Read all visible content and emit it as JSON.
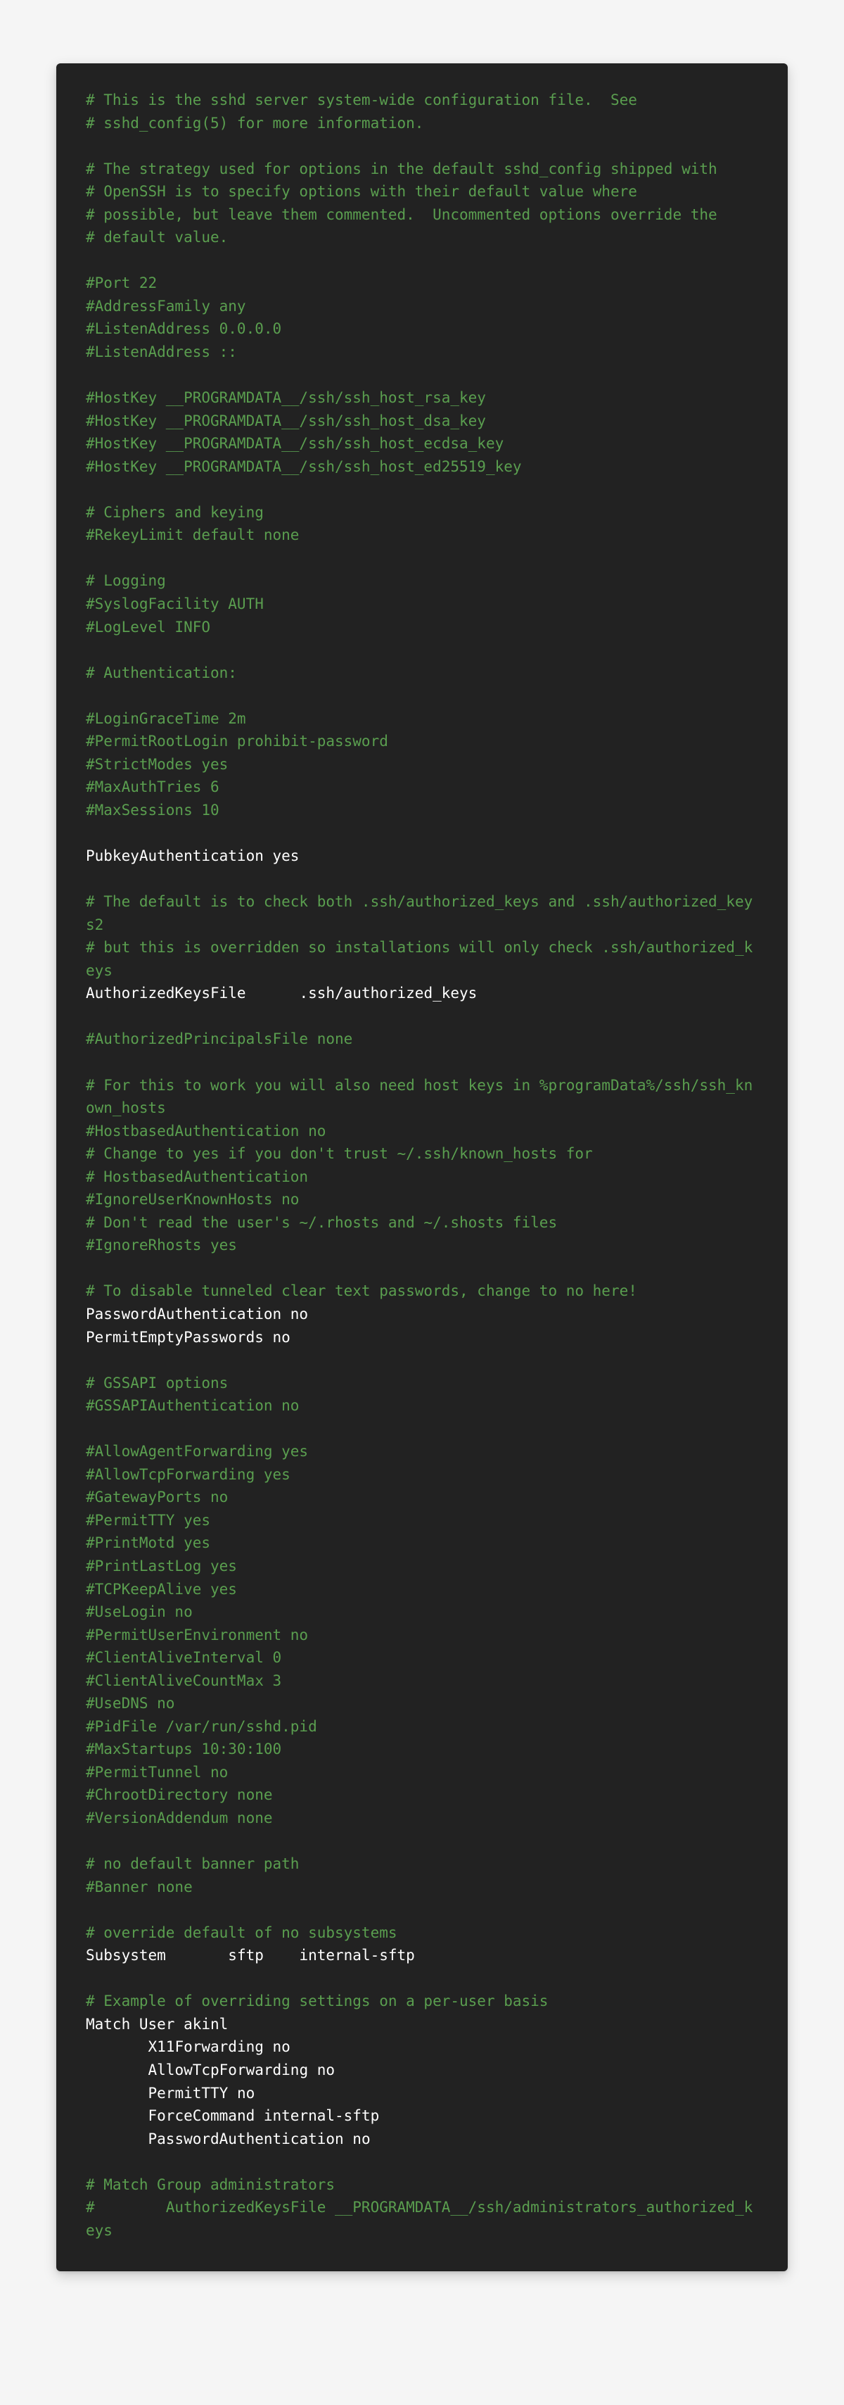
{
  "config": {
    "lines": [
      {
        "text": "# This is the sshd server system-wide configuration file.  See",
        "kind": "comment"
      },
      {
        "text": "# sshd_config(5) for more information.",
        "kind": "comment"
      },
      {
        "text": "",
        "kind": "blank"
      },
      {
        "text": "# The strategy used for options in the default sshd_config shipped with",
        "kind": "comment"
      },
      {
        "text": "# OpenSSH is to specify options with their default value where",
        "kind": "comment"
      },
      {
        "text": "# possible, but leave them commented.  Uncommented options override the",
        "kind": "comment"
      },
      {
        "text": "# default value.",
        "kind": "comment"
      },
      {
        "text": "",
        "kind": "blank"
      },
      {
        "text": "#Port 22",
        "kind": "comment"
      },
      {
        "text": "#AddressFamily any",
        "kind": "comment"
      },
      {
        "text": "#ListenAddress 0.0.0.0",
        "kind": "comment"
      },
      {
        "text": "#ListenAddress ::",
        "kind": "comment"
      },
      {
        "text": "",
        "kind": "blank"
      },
      {
        "text": "#HostKey __PROGRAMDATA__/ssh/ssh_host_rsa_key",
        "kind": "comment"
      },
      {
        "text": "#HostKey __PROGRAMDATA__/ssh/ssh_host_dsa_key",
        "kind": "comment"
      },
      {
        "text": "#HostKey __PROGRAMDATA__/ssh/ssh_host_ecdsa_key",
        "kind": "comment"
      },
      {
        "text": "#HostKey __PROGRAMDATA__/ssh/ssh_host_ed25519_key",
        "kind": "comment"
      },
      {
        "text": "",
        "kind": "blank"
      },
      {
        "text": "# Ciphers and keying",
        "kind": "comment"
      },
      {
        "text": "#RekeyLimit default none",
        "kind": "comment"
      },
      {
        "text": "",
        "kind": "blank"
      },
      {
        "text": "# Logging",
        "kind": "comment"
      },
      {
        "text": "#SyslogFacility AUTH",
        "kind": "comment"
      },
      {
        "text": "#LogLevel INFO",
        "kind": "comment"
      },
      {
        "text": "",
        "kind": "blank"
      },
      {
        "text": "# Authentication:",
        "kind": "comment"
      },
      {
        "text": "",
        "kind": "blank"
      },
      {
        "text": "#LoginGraceTime 2m",
        "kind": "comment"
      },
      {
        "text": "#PermitRootLogin prohibit-password",
        "kind": "comment"
      },
      {
        "text": "#StrictModes yes",
        "kind": "comment"
      },
      {
        "text": "#MaxAuthTries 6",
        "kind": "comment"
      },
      {
        "text": "#MaxSessions 10",
        "kind": "comment"
      },
      {
        "text": "",
        "kind": "blank"
      },
      {
        "text": "PubkeyAuthentication yes",
        "kind": "active"
      },
      {
        "text": "",
        "kind": "blank"
      },
      {
        "text": "# The default is to check both .ssh/authorized_keys and .ssh/authorized_keys2",
        "kind": "comment"
      },
      {
        "text": "# but this is overridden so installations will only check .ssh/authorized_keys",
        "kind": "comment"
      },
      {
        "text": "AuthorizedKeysFile\t.ssh/authorized_keys",
        "kind": "active"
      },
      {
        "text": "",
        "kind": "blank"
      },
      {
        "text": "#AuthorizedPrincipalsFile none",
        "kind": "comment"
      },
      {
        "text": "",
        "kind": "blank"
      },
      {
        "text": "# For this to work you will also need host keys in %programData%/ssh/ssh_known_hosts",
        "kind": "comment"
      },
      {
        "text": "#HostbasedAuthentication no",
        "kind": "comment"
      },
      {
        "text": "# Change to yes if you don't trust ~/.ssh/known_hosts for",
        "kind": "comment"
      },
      {
        "text": "# HostbasedAuthentication",
        "kind": "comment"
      },
      {
        "text": "#IgnoreUserKnownHosts no",
        "kind": "comment"
      },
      {
        "text": "# Don't read the user's ~/.rhosts and ~/.shosts files",
        "kind": "comment"
      },
      {
        "text": "#IgnoreRhosts yes",
        "kind": "comment"
      },
      {
        "text": "",
        "kind": "blank"
      },
      {
        "text": "# To disable tunneled clear text passwords, change to no here!",
        "kind": "comment"
      },
      {
        "text": "PasswordAuthentication no",
        "kind": "active"
      },
      {
        "text": "PermitEmptyPasswords no",
        "kind": "active"
      },
      {
        "text": "",
        "kind": "blank"
      },
      {
        "text": "# GSSAPI options",
        "kind": "comment"
      },
      {
        "text": "#GSSAPIAuthentication no",
        "kind": "comment"
      },
      {
        "text": "",
        "kind": "blank"
      },
      {
        "text": "#AllowAgentForwarding yes",
        "kind": "comment"
      },
      {
        "text": "#AllowTcpForwarding yes",
        "kind": "comment"
      },
      {
        "text": "#GatewayPorts no",
        "kind": "comment"
      },
      {
        "text": "#PermitTTY yes",
        "kind": "comment"
      },
      {
        "text": "#PrintMotd yes",
        "kind": "comment"
      },
      {
        "text": "#PrintLastLog yes",
        "kind": "comment"
      },
      {
        "text": "#TCPKeepAlive yes",
        "kind": "comment"
      },
      {
        "text": "#UseLogin no",
        "kind": "comment"
      },
      {
        "text": "#PermitUserEnvironment no",
        "kind": "comment"
      },
      {
        "text": "#ClientAliveInterval 0",
        "kind": "comment"
      },
      {
        "text": "#ClientAliveCountMax 3",
        "kind": "comment"
      },
      {
        "text": "#UseDNS no",
        "kind": "comment"
      },
      {
        "text": "#PidFile /var/run/sshd.pid",
        "kind": "comment"
      },
      {
        "text": "#MaxStartups 10:30:100",
        "kind": "comment"
      },
      {
        "text": "#PermitTunnel no",
        "kind": "comment"
      },
      {
        "text": "#ChrootDirectory none",
        "kind": "comment"
      },
      {
        "text": "#VersionAddendum none",
        "kind": "comment"
      },
      {
        "text": "",
        "kind": "blank"
      },
      {
        "text": "# no default banner path",
        "kind": "comment"
      },
      {
        "text": "#Banner none",
        "kind": "comment"
      },
      {
        "text": "",
        "kind": "blank"
      },
      {
        "text": "# override default of no subsystems",
        "kind": "comment"
      },
      {
        "text": "Subsystem\tsftp\tinternal-sftp",
        "kind": "active"
      },
      {
        "text": "",
        "kind": "blank"
      },
      {
        "text": "# Example of overriding settings on a per-user basis",
        "kind": "comment"
      },
      {
        "text": "Match User akinl",
        "kind": "active"
      },
      {
        "text": "       X11Forwarding no",
        "kind": "active"
      },
      {
        "text": "       AllowTcpForwarding no",
        "kind": "active"
      },
      {
        "text": "       PermitTTY no",
        "kind": "active"
      },
      {
        "text": "       ForceCommand internal-sftp",
        "kind": "active"
      },
      {
        "text": "       PasswordAuthentication no",
        "kind": "active"
      },
      {
        "text": "",
        "kind": "blank"
      },
      {
        "text": "# Match Group administrators",
        "kind": "comment"
      },
      {
        "text": "#        AuthorizedKeysFile __PROGRAMDATA__/ssh/administrators_authorized_keys",
        "kind": "comment"
      }
    ]
  }
}
